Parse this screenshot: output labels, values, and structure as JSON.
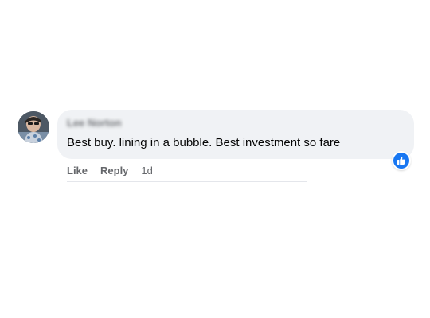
{
  "comment": {
    "author": "Lee Norton",
    "text": "Best buy. lining in a bubble. Best investment so fare",
    "actions": {
      "like": "Like",
      "reply": "Reply",
      "timestamp": "1d"
    },
    "reaction_icon": "thumbs-up-icon"
  },
  "colors": {
    "bubble": "#f0f2f5",
    "text": "#050505",
    "secondary_text": "#65676b",
    "reaction_blue": "#1877f2"
  }
}
